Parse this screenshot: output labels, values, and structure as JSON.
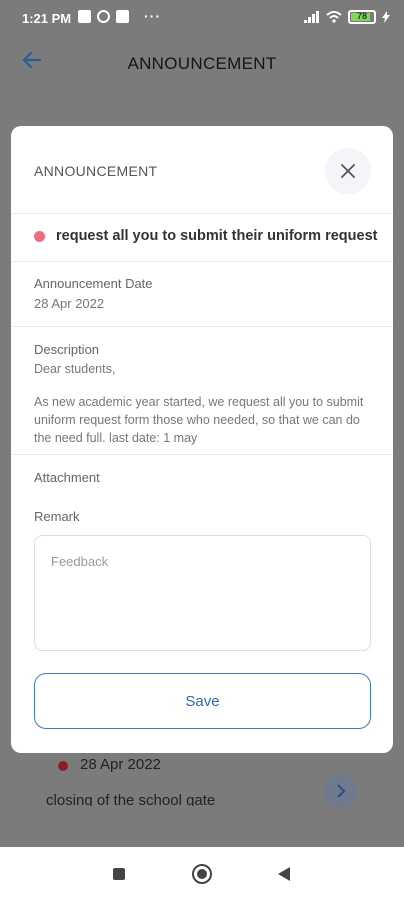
{
  "status_bar": {
    "time": "1:21 PM",
    "overflow": "···",
    "battery": "78"
  },
  "app_bar": {
    "title": "ANNOUNCEMENT"
  },
  "background_list": {
    "date": "28 Apr 2022",
    "text": "closing of the school gate"
  },
  "modal": {
    "heading": "ANNOUNCEMENT",
    "subject": "request all you to submit their uniform request",
    "date_label": "Announcement Date",
    "date_value": "28 Apr 2022",
    "description_label": "Description",
    "description_greeting": "Dear students,",
    "description_body": "As new academic year started, we request all you to submit uniform request form those who needed, so that we can do the need full. last date: 1 may",
    "attachment_label": "Attachment",
    "remark_label": "Remark",
    "feedback_placeholder": "Feedback",
    "save_label": "Save"
  },
  "colors": {
    "accent": "#2f69a8",
    "subject_dot": "#ec6f7f",
    "overlay": "#7b7b7b"
  }
}
